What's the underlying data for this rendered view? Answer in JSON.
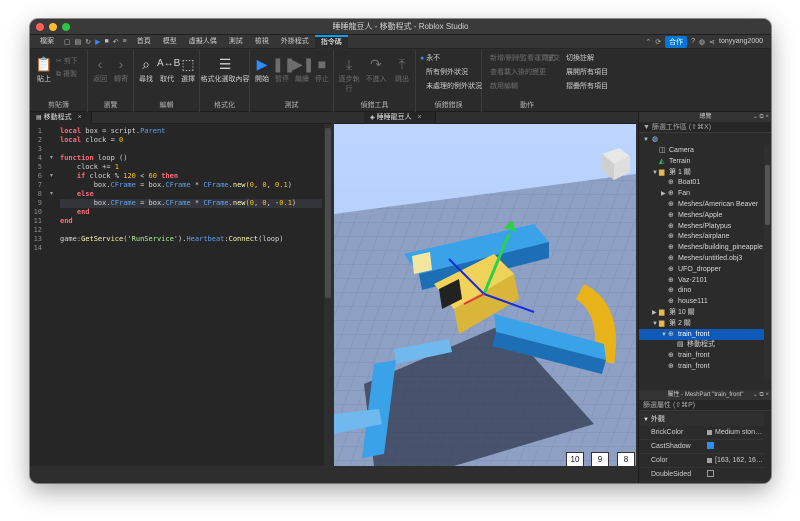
{
  "window": {
    "title": "睡睡龍豆人 - 移動程式 - Roblox Studio"
  },
  "menu": {
    "file": "檔案",
    "tabs": [
      "首頁",
      "模型",
      "虛擬人偶",
      "測試",
      "檢視",
      "外掛程式",
      "指令碼"
    ],
    "active_tab": "指令碼",
    "collaborate": "合作",
    "username": "tonyyang2000"
  },
  "ribbon": {
    "clipboard": {
      "label": "剪貼簿",
      "paste": "貼上",
      "cut": "剪下",
      "copy": "複製"
    },
    "navigate": {
      "label": "瀏覽",
      "back": "返回",
      "forward": "轉寄"
    },
    "edit": {
      "label": "編輯",
      "find": "尋找",
      "replace": "取代",
      "select": "選擇"
    },
    "format": {
      "label": "格式化",
      "format_selection": "格式化選取內容"
    },
    "test": {
      "label": "測試",
      "play": "開始",
      "pause": "暫停",
      "resume": "繼續",
      "stop": "停止"
    },
    "debug_tools": {
      "label": "偵錯工具",
      "step_into": "逐步執行",
      "step_over": "不進入",
      "step_out": "跳出"
    },
    "debug_errors": {
      "label": "偵錯錯誤",
      "never": "永不",
      "all_exceptions": "所有例外狀況",
      "unhandled": "未處理的例外狀況"
    },
    "actions": {
      "label": "動作",
      "add_watch": "新增/刪除監看運算式",
      "commit": "提交",
      "diff": "查看載入後的變更",
      "enable": "啟用編輯",
      "toggle_comment": "切換註解",
      "expand_all": "展開所有項目",
      "collapse_all": "摺疊所有項目"
    }
  },
  "script_tab": {
    "name": "移動程式"
  },
  "code": {
    "line_numbers": [
      "1",
      "2",
      "3",
      "4",
      "5",
      "6",
      "7",
      "8",
      "9",
      "10",
      "11",
      "12",
      "13",
      "14"
    ],
    "lines": [
      [
        [
          "kw",
          "local"
        ],
        [
          "p",
          " box = script."
        ],
        [
          "prop",
          "Parent"
        ]
      ],
      [
        [
          "kw",
          "local"
        ],
        [
          "p",
          " clock = "
        ],
        [
          "num",
          "0"
        ]
      ],
      [
        [
          "p",
          ""
        ]
      ],
      [
        [
          "kw",
          "function"
        ],
        [
          "p",
          " loop ()"
        ]
      ],
      [
        [
          "p",
          "    clock += "
        ],
        [
          "num",
          "1"
        ]
      ],
      [
        [
          "p",
          "    "
        ],
        [
          "kw",
          "if"
        ],
        [
          "p",
          " clock % "
        ],
        [
          "num",
          "120"
        ],
        [
          "p",
          " < "
        ],
        [
          "num",
          "60"
        ],
        [
          "p",
          " "
        ],
        [
          "kw",
          "then"
        ]
      ],
      [
        [
          "p",
          "        box."
        ],
        [
          "prop",
          "CFrame"
        ],
        [
          "p",
          " = box."
        ],
        [
          "prop",
          "CFrame"
        ],
        [
          "p",
          " * "
        ],
        [
          "prop",
          "CFrame"
        ],
        [
          "p",
          "."
        ],
        [
          "fn",
          "new"
        ],
        [
          "p",
          "("
        ],
        [
          "num",
          "0"
        ],
        [
          "p",
          ", "
        ],
        [
          "num",
          "0"
        ],
        [
          "p",
          ", "
        ],
        [
          "num",
          "0.1"
        ],
        [
          "p",
          ")"
        ]
      ],
      [
        [
          "p",
          "    "
        ],
        [
          "kw",
          "else"
        ]
      ],
      [
        [
          "p",
          "        box."
        ],
        [
          "prop",
          "CFrame"
        ],
        [
          "p",
          " = box."
        ],
        [
          "prop",
          "CFrame"
        ],
        [
          "p",
          " * "
        ],
        [
          "prop",
          "CFrame"
        ],
        [
          "p",
          "."
        ],
        [
          "fn",
          "new"
        ],
        [
          "p",
          "("
        ],
        [
          "num",
          "0"
        ],
        [
          "p",
          ", "
        ],
        [
          "num",
          "0"
        ],
        [
          "p",
          ", -"
        ],
        [
          "num",
          "0.1"
        ],
        [
          "p",
          ")"
        ]
      ],
      [
        [
          "p",
          "    "
        ],
        [
          "kw",
          "end"
        ]
      ],
      [
        [
          "kw",
          "end"
        ]
      ],
      [
        [
          "p",
          ""
        ]
      ],
      [
        [
          "p",
          "game:"
        ],
        [
          "fn",
          "GetService"
        ],
        [
          "p",
          "("
        ],
        [
          "str",
          "'RunService'"
        ],
        [
          "p",
          ")."
        ],
        [
          "prop",
          "Heartbeat"
        ],
        [
          "p",
          ":"
        ],
        [
          "fn",
          "Connect"
        ],
        [
          "p",
          "(loop)"
        ]
      ],
      [
        [
          "p",
          ""
        ]
      ]
    ]
  },
  "viewport": {
    "tab": "睡睡龍豆人",
    "index_labels": [
      "10",
      "9",
      "8"
    ]
  },
  "explorer": {
    "title": "總覽",
    "filter": "篩選工作區 (⇧⌘X)",
    "items": [
      {
        "label": "Camera",
        "icon": "camera-icon",
        "level": 1,
        "arrow": ""
      },
      {
        "label": "Terrain",
        "icon": "terrain-icon",
        "level": 1,
        "arrow": ""
      },
      {
        "label": "第 1 關",
        "icon": "folder-icon",
        "level": 1,
        "arrow": "▼"
      },
      {
        "label": "Boat01",
        "icon": "mesh-icon",
        "level": 2,
        "arrow": ""
      },
      {
        "label": "Fan",
        "icon": "mesh-icon",
        "level": 2,
        "arrow": "▶"
      },
      {
        "label": "Meshes/American Beaver",
        "icon": "mesh-icon",
        "level": 2,
        "arrow": ""
      },
      {
        "label": "Meshes/Apple",
        "icon": "mesh-icon",
        "level": 2,
        "arrow": ""
      },
      {
        "label": "Meshes/Platypus",
        "icon": "mesh-icon",
        "level": 2,
        "arrow": ""
      },
      {
        "label": "Meshes/airplane",
        "icon": "mesh-icon",
        "level": 2,
        "arrow": ""
      },
      {
        "label": "Meshes/building_pineapple",
        "icon": "mesh-icon",
        "level": 2,
        "arrow": ""
      },
      {
        "label": "Meshes/untitled.obj3",
        "icon": "mesh-icon",
        "level": 2,
        "arrow": ""
      },
      {
        "label": "UFO_dropper",
        "icon": "mesh-icon",
        "level": 2,
        "arrow": ""
      },
      {
        "label": "Vaz-2101",
        "icon": "mesh-icon",
        "level": 2,
        "arrow": ""
      },
      {
        "label": "dino",
        "icon": "mesh-icon",
        "level": 2,
        "arrow": ""
      },
      {
        "label": "house111",
        "icon": "mesh-icon",
        "level": 2,
        "arrow": ""
      },
      {
        "label": "第 10 關",
        "icon": "folder-icon",
        "level": 1,
        "arrow": "▶"
      },
      {
        "label": "第 2 關",
        "icon": "folder-icon",
        "level": 1,
        "arrow": "▼"
      },
      {
        "label": "train_front",
        "icon": "mesh-icon",
        "level": 2,
        "arrow": "▼",
        "selected": true
      },
      {
        "label": "移動程式",
        "icon": "script-icon",
        "level": 3,
        "arrow": ""
      },
      {
        "label": "train_front",
        "icon": "mesh-icon",
        "level": 2,
        "arrow": ""
      },
      {
        "label": "train_front",
        "icon": "mesh-icon",
        "level": 2,
        "arrow": ""
      }
    ],
    "workspace_label": "篩選工作區 (⇧⌘X)"
  },
  "properties": {
    "title": "屬性 - MeshPart \"train_front\"",
    "filter": "篩選屬性 (⇧⌘P)",
    "section": "外觀",
    "rows": [
      {
        "name": "BrickColor",
        "value": "Medium ston…",
        "kind": "swatch"
      },
      {
        "name": "CastShadow",
        "value": "",
        "kind": "check-on"
      },
      {
        "name": "Color",
        "value": "[163, 162, 16…",
        "kind": "swatch"
      },
      {
        "name": "DoubleSided",
        "value": "",
        "kind": "check-off"
      }
    ]
  },
  "colors": {
    "accent": "#00a2ff",
    "selection": "#0f5ab8",
    "keyword": "#f86d7c",
    "number": "#ffc600",
    "string": "#adf195",
    "property": "#61a1f1"
  }
}
